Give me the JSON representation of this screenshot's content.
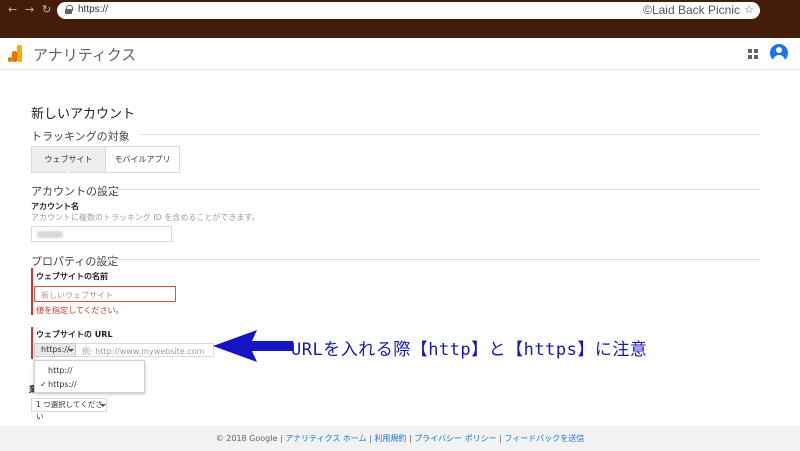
{
  "browser": {
    "url": "https://",
    "credit": "©Laid Back Picnic",
    "star_glyph": "☆"
  },
  "app": {
    "title": "アナリティクス"
  },
  "form": {
    "page_title": "新しいアカウント",
    "tracking": {
      "section_title": "トラッキングの対象",
      "tabs": [
        {
          "label": "ウェブサイト",
          "active": true
        },
        {
          "label": "モバイルアプリ",
          "active": false
        }
      ]
    },
    "account": {
      "section_title": "アカウントの設定",
      "name_label": "アカウント名",
      "name_help": "アカウントに複数のトラッキング ID を含めることができます。"
    },
    "property": {
      "section_title": "プロパティの設定",
      "site_name_label": "ウェブサイトの名前",
      "site_name_placeholder": "新しいウェブサイト",
      "site_name_error": "値を指定してください。",
      "site_url_label": "ウェブサイトの URL",
      "protocol_selected": "https://",
      "url_placeholder": "例: http://www.mywebsite.com",
      "protocol_options": [
        "http://",
        "https://"
      ],
      "checked_option": "✓",
      "partial_label": "業",
      "category_select": "1 つ選択してください"
    }
  },
  "annotation": {
    "text": "URLを入れる際【http】と【https】に注意",
    "color": "#1515c8"
  },
  "footer": {
    "copyright": "© 2018 Google",
    "links": [
      "アナリティクス ホーム",
      "利用規約",
      "プライバシー ポリシー",
      "フィードバックを送信"
    ],
    "separator": "|"
  },
  "colors": {
    "chrome_bar": "#441c0a",
    "error": "#d93025",
    "link": "#1a73e8",
    "logo_yellow": "#f9ab00",
    "logo_orange": "#e37400"
  }
}
